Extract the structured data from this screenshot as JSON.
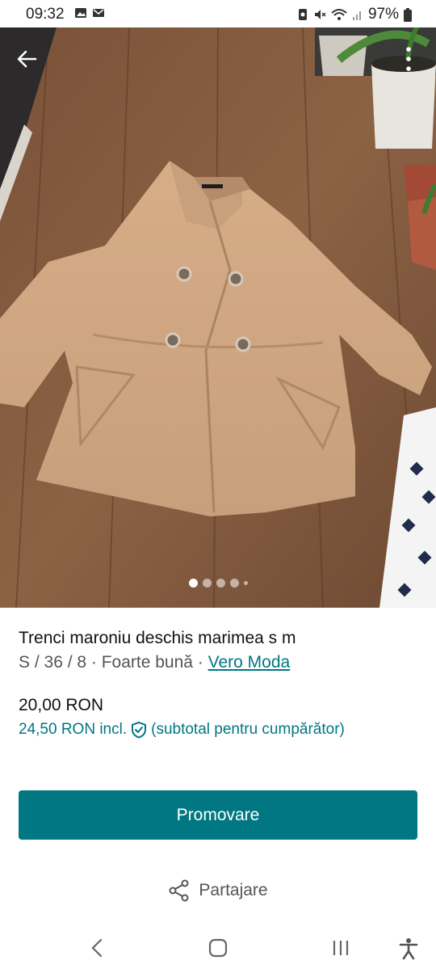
{
  "status_bar": {
    "time": "09:32",
    "battery": "97%",
    "icons": [
      "gallery-icon",
      "mail-icon",
      "sync-icon",
      "mute-icon",
      "wifi-icon",
      "signal-icon",
      "battery-icon"
    ]
  },
  "gallery": {
    "image_count": 5,
    "active_index": 0
  },
  "listing": {
    "title": "Trenci maroniu deschis marimea s m",
    "meta_prefix": "S / 36 / 8 · Foarte bună · ",
    "brand": "Vero Moda",
    "price": "20,00 RON",
    "price_incl": "24,50 RON incl.",
    "price_incl_note": "(subtotal pentru cumpărător)"
  },
  "actions": {
    "promote_label": "Promovare",
    "share_label": "Partajare"
  },
  "colors": {
    "accent": "#007782"
  }
}
